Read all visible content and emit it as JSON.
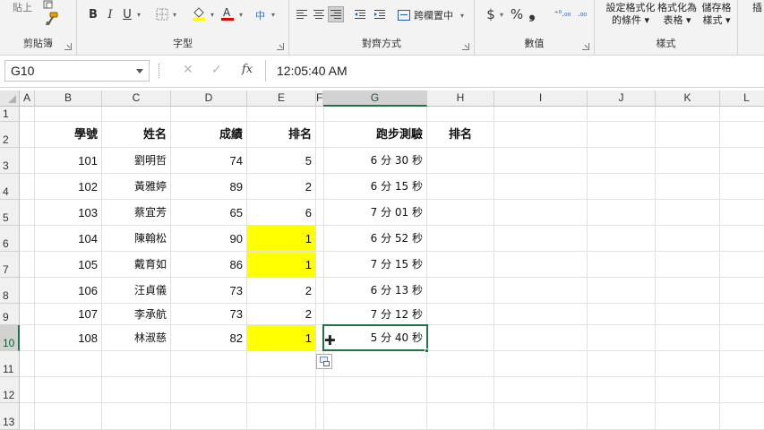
{
  "ribbon": {
    "paste_label": "貼上",
    "groups": [
      {
        "id": "clipboard",
        "label": "剪貼簿"
      },
      {
        "id": "font",
        "label": "字型"
      },
      {
        "id": "alignment",
        "label": "對齊方式"
      },
      {
        "id": "number",
        "label": "數值"
      },
      {
        "id": "styles",
        "label": "樣式"
      }
    ],
    "font_buttons": {
      "bold": "B",
      "italic": "I",
      "underline": "U"
    },
    "merge_label": "跨欄置中",
    "number_buttons": {
      "currency": "$",
      "percent": "%",
      "comma": "❟",
      "inc_decimal": "⁺⁰.₀₀",
      "dec_decimal": ".₀₀"
    },
    "style_buttons": [
      {
        "line1": "設定格式化",
        "line2": "的條件 ▾"
      },
      {
        "line1": "格式化為",
        "line2": "表格 ▾"
      },
      {
        "line1": "儲存格",
        "line2": "樣式 ▾"
      }
    ],
    "insert_partial": "插"
  },
  "formula_bar": {
    "name_box": "G10",
    "cancel": "✕",
    "enter": "✓",
    "fx": "fx",
    "content": "12:05:40 AM"
  },
  "columns": [
    "A",
    "B",
    "C",
    "D",
    "E",
    "F",
    "G",
    "H",
    "I",
    "J",
    "K",
    "L"
  ],
  "selected_column": "G",
  "rows": [
    "1",
    "2",
    "3",
    "4",
    "5",
    "6",
    "7",
    "8",
    "9",
    "10",
    "11",
    "12",
    "13"
  ],
  "selected_row": "10",
  "headers": {
    "B": "學號",
    "C": "姓名",
    "D": "成績",
    "E": "排名",
    "G": "跑步測驗",
    "H": "排名"
  },
  "data_rows": [
    {
      "B": "101",
      "C": "劉明哲",
      "D": "74",
      "E": "5",
      "G": "6 分 30 秒",
      "hl": false
    },
    {
      "B": "102",
      "C": "黃雅婷",
      "D": "89",
      "E": "2",
      "G": "6 分 15 秒",
      "hl": false
    },
    {
      "B": "103",
      "C": "蔡宜芳",
      "D": "65",
      "E": "6",
      "G": "7 分 01 秒",
      "hl": false
    },
    {
      "B": "104",
      "C": "陳翰松",
      "D": "90",
      "E": "1",
      "G": "6 分 52 秒",
      "hl": true
    },
    {
      "B": "105",
      "C": "戴育如",
      "D": "86",
      "E": "1",
      "G": "7 分 15 秒",
      "hl": true
    },
    {
      "B": "106",
      "C": "汪貞儀",
      "D": "73",
      "E": "2",
      "G": "6 分 13 秒",
      "hl": false
    },
    {
      "B": "107",
      "C": "李承航",
      "D": "73",
      "E": "2",
      "G": "7 分 12 秒",
      "hl": false
    },
    {
      "B": "108",
      "C": "林淑慈",
      "D": "82",
      "E": "1",
      "G": "5 分 40 秒",
      "hl": true
    }
  ],
  "colors": {
    "highlight": "#ffff00",
    "accent": "#217346"
  },
  "icons": [
    "cut-icon",
    "paint-format-icon",
    "border-icon",
    "fill-color-icon",
    "font-color-icon",
    "phonetic-icon",
    "align-left-icon",
    "align-center-icon",
    "align-right-icon",
    "decrease-indent-icon",
    "increase-indent-icon",
    "merge-center-icon",
    "quick-analysis-icon",
    "cell-cursor-icon"
  ]
}
